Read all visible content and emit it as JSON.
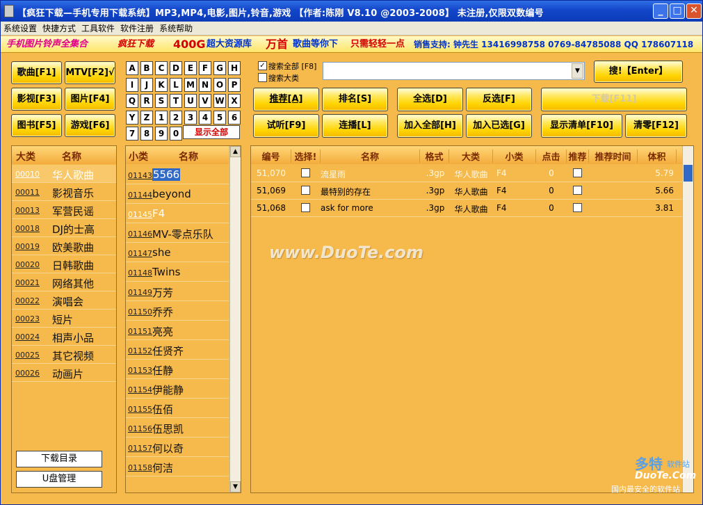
{
  "window": {
    "title": "【疯狂下载—手机专用下载系统】MP3,MP4,电影,图片,铃音,游戏 【作者:陈刚 V8.10 @2003-2008】   未注册,仅限双数编号",
    "min": "_",
    "max": "□",
    "close": "✕"
  },
  "menu": [
    "系统设置",
    "快捷方式",
    "工具软件",
    "软件注册",
    "系统帮助"
  ],
  "ad": {
    "a": "手机图片铃声全集合",
    "b": "疯狂下载",
    "c": "400G",
    "d": "超大资源库",
    "e": "万首",
    "f": "歌曲等你下",
    "g": "只需轻轻一点",
    "h": "销售支持: 钟先生  13416998758  0769-84785088  QQ 178607118"
  },
  "category_buttons": [
    "歌曲[F1]",
    "MTV[F2]√",
    "影视[F3]",
    "图片[F4]",
    "图书[F5]",
    "游戏[F6]"
  ],
  "keys": [
    "A",
    "B",
    "C",
    "D",
    "E",
    "F",
    "G",
    "H",
    "I",
    "J",
    "K",
    "L",
    "M",
    "N",
    "O",
    "P",
    "Q",
    "R",
    "S",
    "T",
    "U",
    "V",
    "W",
    "X",
    "Y",
    "Z",
    "1",
    "2",
    "3",
    "4",
    "5",
    "6",
    "7",
    "8",
    "9",
    "0"
  ],
  "show_all": "显示全部",
  "search": {
    "all_label": "搜索全部 [F8]",
    "big_label": "搜索大类",
    "value": "",
    "button": "搜!【Enter】"
  },
  "actions": {
    "recommend": "推荐[A]",
    "rank": "排名[S]",
    "select_all": "全选[D]",
    "invert": "反选[F]",
    "download": "下载[F11]",
    "listen": "试听[F9]",
    "autoplay": "连播[L]",
    "add_all": "加入全部[H]",
    "add_selected": "加入已选[G]",
    "show_list": "显示清单[F10]",
    "clear": "清零[F12]"
  },
  "big_list": {
    "headers": [
      "大类",
      "名称"
    ],
    "items": [
      {
        "code": "00010",
        "name": "华人歌曲"
      },
      {
        "code": "00011",
        "name": "影视音乐"
      },
      {
        "code": "00013",
        "name": "军营民谣"
      },
      {
        "code": "00018",
        "name": "DJ的士高"
      },
      {
        "code": "00019",
        "name": "欧美歌曲"
      },
      {
        "code": "00020",
        "name": "日韩歌曲"
      },
      {
        "code": "00021",
        "name": "网络其他"
      },
      {
        "code": "00022",
        "name": "演唱会"
      },
      {
        "code": "00023",
        "name": "短片"
      },
      {
        "code": "00024",
        "name": "相声小品"
      },
      {
        "code": "00025",
        "name": "其它视频"
      },
      {
        "code": "00026",
        "name": "动画片"
      }
    ]
  },
  "bottom_buttons": {
    "download_dir": "下载目录",
    "usb": "U盘管理"
  },
  "small_list": {
    "headers": [
      "小类",
      "名称"
    ],
    "items": [
      {
        "code": "01143",
        "name": "5566"
      },
      {
        "code": "01144",
        "name": "beyond"
      },
      {
        "code": "01145",
        "name": "F4"
      },
      {
        "code": "01146",
        "name": "MV-零点乐队"
      },
      {
        "code": "01147",
        "name": "she"
      },
      {
        "code": "01148",
        "name": "Twins"
      },
      {
        "code": "01149",
        "name": "万芳"
      },
      {
        "code": "01150",
        "name": "乔乔"
      },
      {
        "code": "01151",
        "name": "亮亮"
      },
      {
        "code": "01152",
        "name": "任贤齐"
      },
      {
        "code": "01153",
        "name": "任静"
      },
      {
        "code": "01154",
        "name": "伊能静"
      },
      {
        "code": "01155",
        "name": "伍佰"
      },
      {
        "code": "01156",
        "name": "伍思凯"
      },
      {
        "code": "01157",
        "name": "何以奇"
      },
      {
        "code": "01158",
        "name": "何洁"
      }
    ]
  },
  "table": {
    "headers": [
      "编号",
      "选择!",
      "名称",
      "格式",
      "大类",
      "小类",
      "点击",
      "推荐",
      "推荐时间",
      "体积"
    ],
    "rows": [
      {
        "id": "51,070",
        "name": "流星雨",
        "fmt": ".3gp",
        "big": "华人歌曲",
        "small": "F4",
        "clicks": "0",
        "size": "5.79"
      },
      {
        "id": "51,069",
        "name": "最特别的存在",
        "fmt": ".3gp",
        "big": "华人歌曲",
        "small": "F4",
        "clicks": "0",
        "size": "5.66"
      },
      {
        "id": "51,068",
        "name": "ask for more",
        "fmt": ".3gp",
        "big": "华人歌曲",
        "small": "F4",
        "clicks": "0",
        "size": "3.81"
      }
    ]
  },
  "watermark": "www.DuoTe.com",
  "corner_logo": {
    "a": "多特",
    "b": "软件站",
    "c": "DuoTe.Com",
    "d": "国内最安全的软件站"
  },
  "colors": {
    "panel": "#f6b94c",
    "button": "#ffd400",
    "titlebar": "#1346c9"
  }
}
